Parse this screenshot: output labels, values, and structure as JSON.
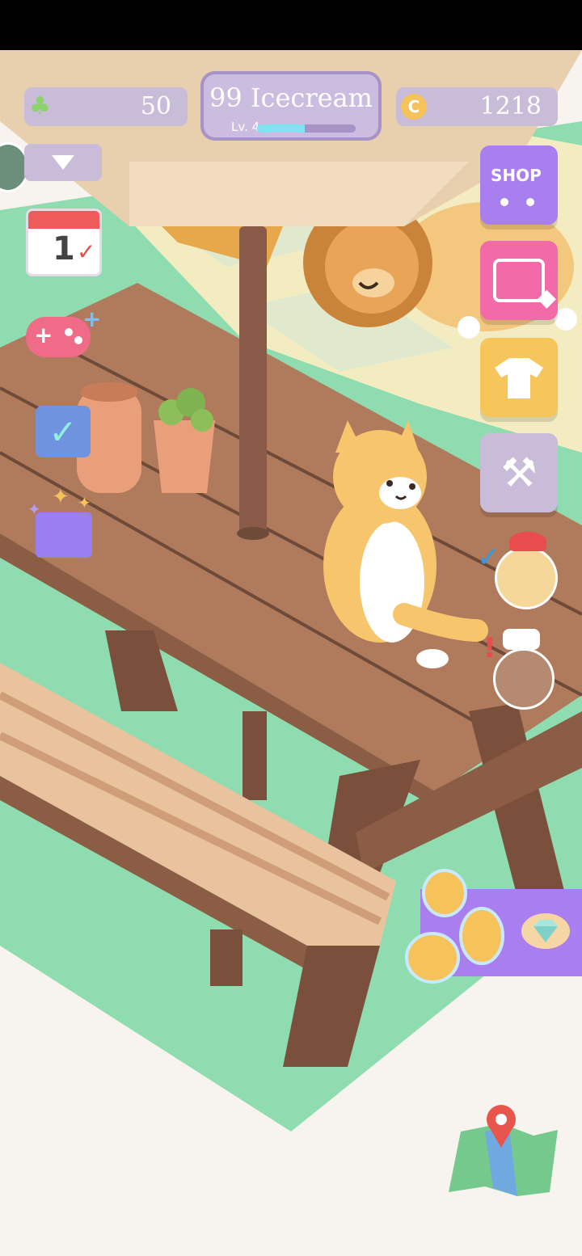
{
  "hud": {
    "clover_count": "50",
    "coin_count": "1218",
    "pet_name": "99 Icecream",
    "level_label": "Lv. 4",
    "level_progress": 0.48
  },
  "right_menu": {
    "shop_label": "SHOP"
  },
  "left_menu": {
    "calendar_day": "1"
  },
  "colors": {
    "status_bar": "#000000",
    "pill": "#c9bcd9",
    "shop_button": "#a97ff0",
    "gift_button": "#f26aa8",
    "wardrobe_button": "#f6c65b",
    "tools_button": "#c9bcd9",
    "grass": "#8fdcb0",
    "table_wood": "#b07a5c"
  },
  "icons": [
    "clover-icon",
    "coin-icon",
    "dropdown-arrow-icon",
    "calendar-icon",
    "gamepad-plus-icon",
    "checklist-icon",
    "mystery-box-icon",
    "shop-cart-icon",
    "chest-gem-icon",
    "tshirt-icon",
    "tools-icon",
    "map-pin-icon",
    "gem-icon",
    "check-icon",
    "exclamation-icon"
  ]
}
